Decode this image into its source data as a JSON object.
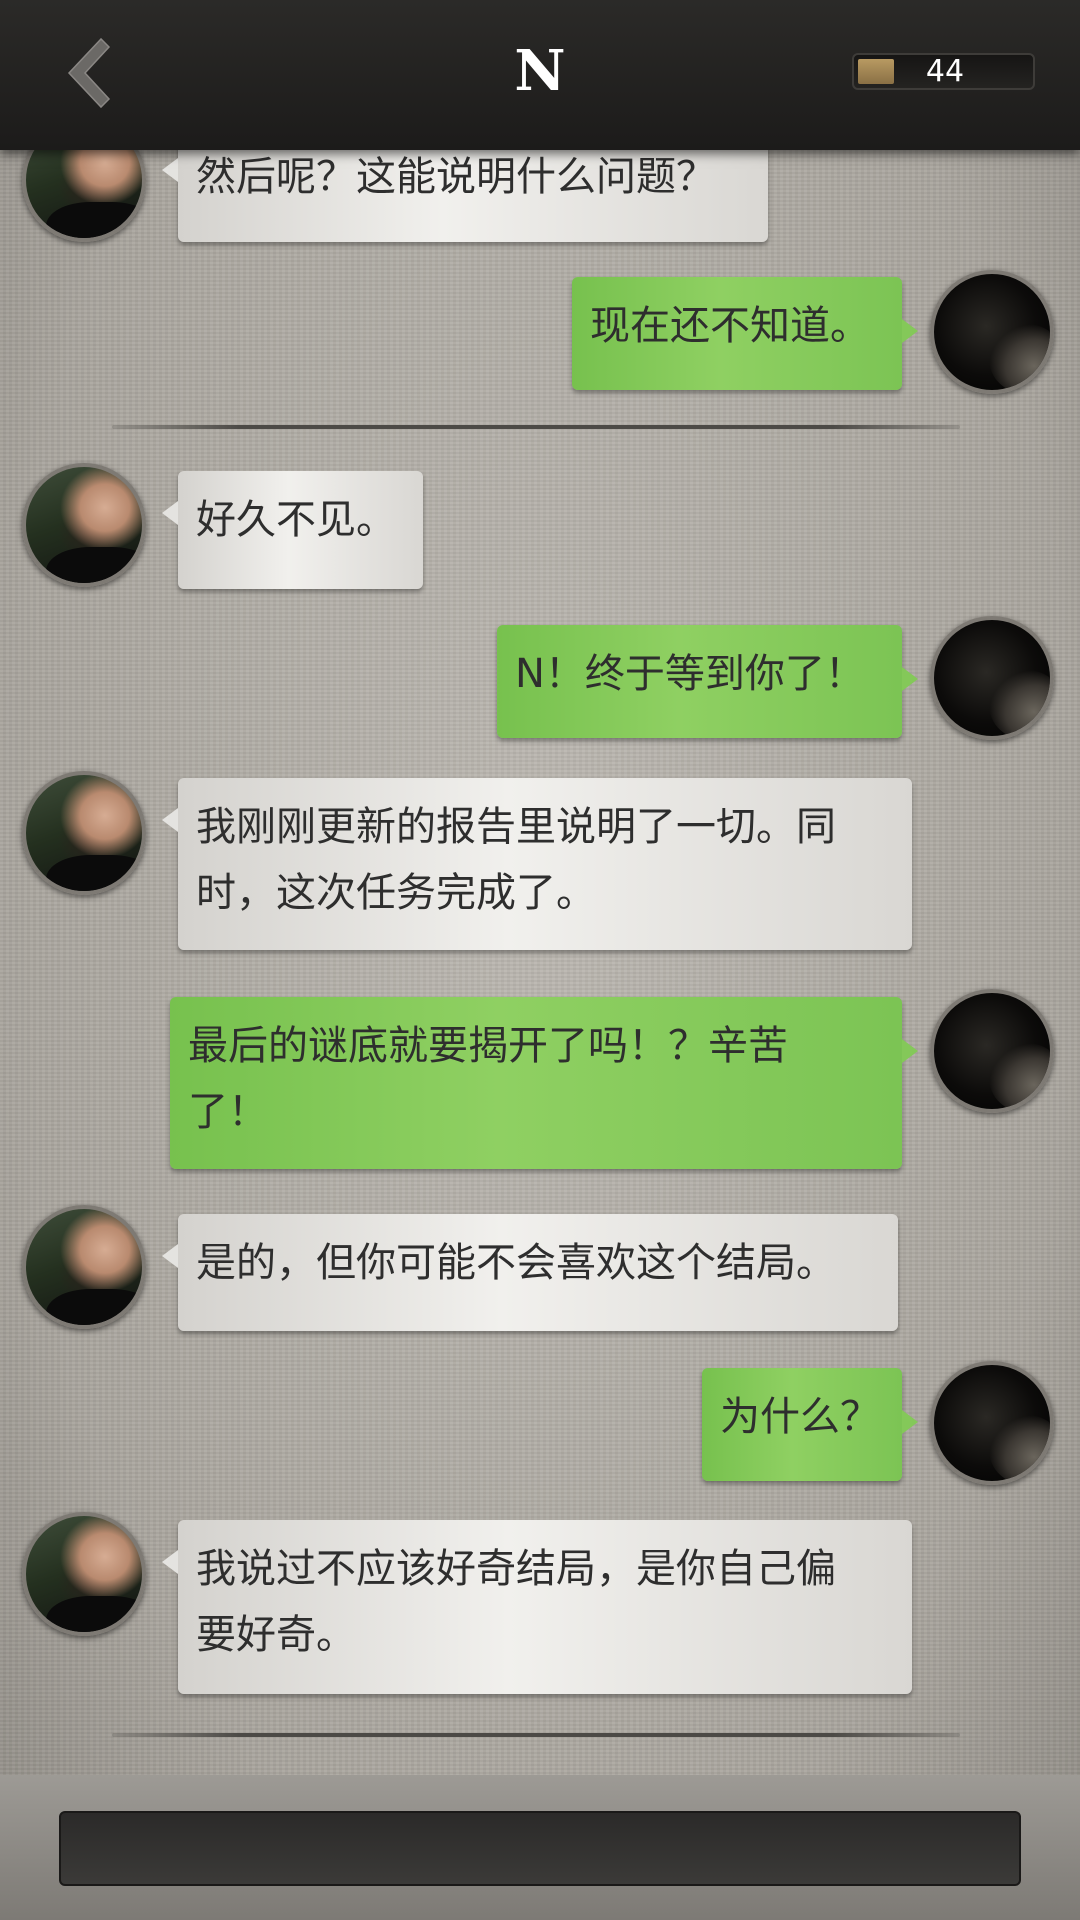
{
  "header": {
    "title": "N",
    "coin_count": "44"
  },
  "messages": [
    {
      "side": "left",
      "speaker": "npc",
      "text_lines": [
        "然后呢？这能说明什么问题？"
      ]
    },
    {
      "side": "right",
      "speaker": "player",
      "text_lines": [
        "现在还不知道。"
      ]
    },
    {
      "side": "left",
      "speaker": "npc",
      "text_lines": [
        "好久不见。"
      ]
    },
    {
      "side": "right",
      "speaker": "player",
      "text_lines": [
        "N！终于等到你了！"
      ]
    },
    {
      "side": "left",
      "speaker": "npc",
      "text_lines": [
        "我刚刚更新的报告里说明了一切。同",
        "时，这次任务完成了。"
      ]
    },
    {
      "side": "right",
      "speaker": "player",
      "text_lines": [
        "最后的谜底就要揭开了吗！？辛苦",
        "了！"
      ]
    },
    {
      "side": "left",
      "speaker": "npc",
      "text_lines": [
        "是的，但你可能不会喜欢这个结局。"
      ]
    },
    {
      "side": "right",
      "speaker": "player",
      "text_lines": [
        "为什么？"
      ]
    },
    {
      "side": "left",
      "speaker": "npc",
      "text_lines": [
        "我说过不应该好奇结局，是你自己偏",
        "要好奇。"
      ]
    }
  ],
  "footer": {
    "input_value": ""
  }
}
